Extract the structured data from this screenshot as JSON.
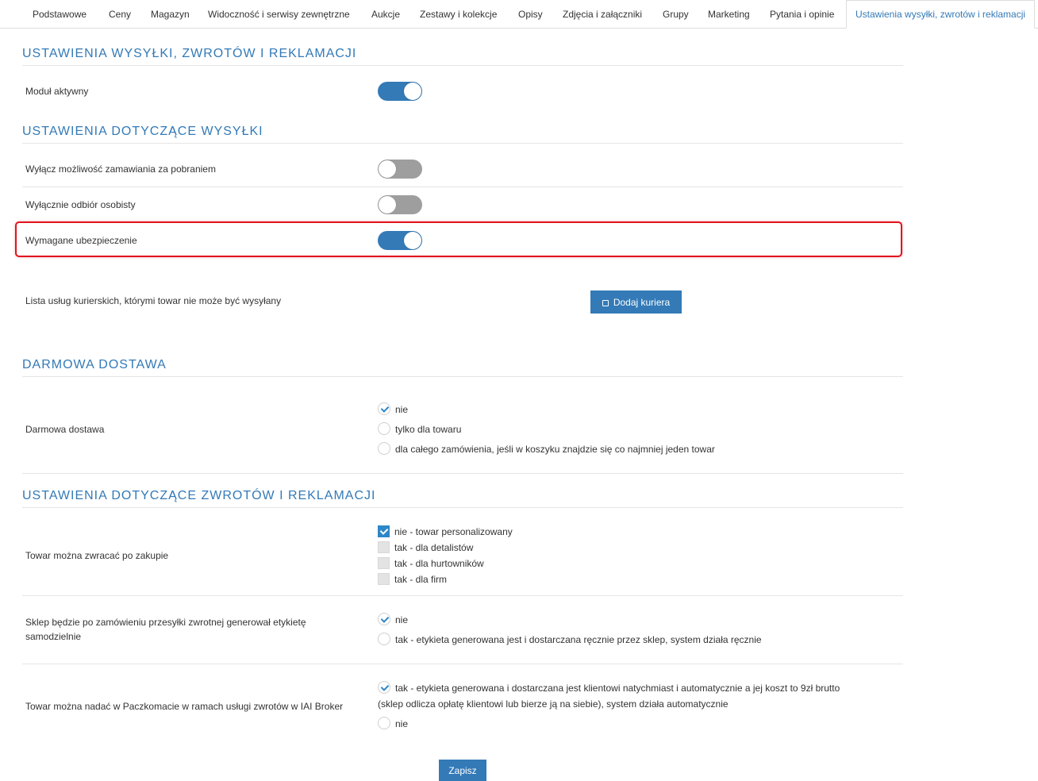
{
  "tabs": [
    {
      "label": "Podstawowe"
    },
    {
      "label": "Ceny"
    },
    {
      "label": "Magazyn"
    },
    {
      "label": "Widoczność i serwisy zewnętrzne"
    },
    {
      "label": "Aukcje"
    },
    {
      "label": "Zestawy i kolekcje"
    },
    {
      "label": "Opisy"
    },
    {
      "label": "Zdjęcia i załączniki"
    },
    {
      "label": "Grupy"
    },
    {
      "label": "Marketing"
    },
    {
      "label": "Pytania i opinie"
    },
    {
      "label": "Ustawienia wysyłki, zwrotów i reklamacji"
    }
  ],
  "active_tab": "Ustawienia wysyłki, zwrotów i reklamacji",
  "section_main": {
    "title": "USTAWIENIA WYSYŁKI, ZWROTÓW I REKLAMACJI",
    "module_label": "Moduł aktywny",
    "module_on": true
  },
  "section_shipping": {
    "title": "USTAWIENIA DOTYCZĄCE WYSYŁKI",
    "cod_label": "Wyłącz możliwość zamawiania za pobraniem",
    "cod_on": false,
    "pickup_label": "Wyłącznie odbiór osobisty",
    "pickup_on": false,
    "insurance_label": "Wymagane ubezpieczenie",
    "insurance_on": true,
    "couriers_label": "Lista usług kurierskich, którymi towar nie może być wysyłany",
    "add_courier_label": "Dodaj kuriera"
  },
  "section_free": {
    "title": "DARMOWA DOSTAWA",
    "label": "Darmowa dostawa",
    "options": [
      {
        "label": "nie",
        "checked": true
      },
      {
        "label": "tylko dla towaru",
        "checked": false
      },
      {
        "label": "dla całego zamówienia, jeśli w koszyku znajdzie się co najmniej jeden towar",
        "checked": false
      }
    ]
  },
  "section_returns": {
    "title": "USTAWIENIA DOTYCZĄCE ZWROTÓW I REKLAMACJI",
    "returnable_label": "Towar można zwracać po zakupie",
    "returnable_options": [
      {
        "label": "nie - towar personalizowany",
        "checked": true
      },
      {
        "label": "tak - dla detalistów",
        "checked": false
      },
      {
        "label": "tak - dla hurtowników",
        "checked": false
      },
      {
        "label": "tak - dla firm",
        "checked": false
      }
    ],
    "label_gen_label": "Sklep będzie po zamówieniu przesyłki zwrotnej generował etykietę samodzielnie",
    "label_gen_options": [
      {
        "label": "nie",
        "checked": true
      },
      {
        "label": "tak - etykieta generowana jest i dostarczana ręcznie przez sklep, system działa ręcznie",
        "checked": false
      }
    ],
    "paczkomat_label": "Towar można nadać w Paczkomacie w ramach usługi zwrotów w IAI Broker",
    "paczkomat_options": [
      {
        "label_line1": "tak - etykieta generowana i dostarczana jest klientowi natychmiast i automatycznie a jej koszt to 9zł brutto",
        "label_line2": "(sklep odlicza opłatę klientowi lub bierze ją na siebie), system działa automatycznie",
        "checked": true
      },
      {
        "label": "nie",
        "checked": false
      }
    ]
  },
  "save_label": "Zapisz",
  "colors": {
    "accent": "#337ab7",
    "highlight": "#e0141e"
  }
}
